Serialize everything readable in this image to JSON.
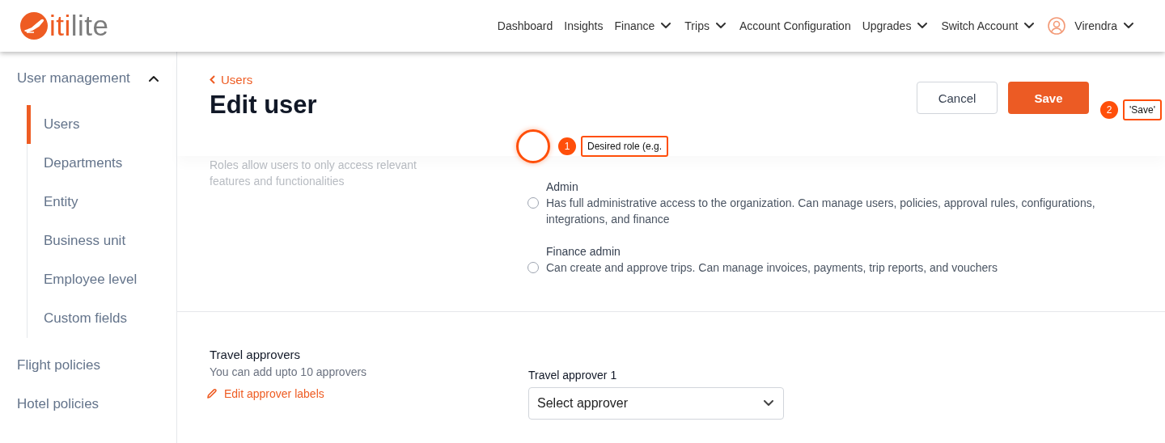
{
  "logo": {
    "accent": "iti",
    "rest": "lite"
  },
  "nav": [
    {
      "label": "Dashboard",
      "dropdown": false
    },
    {
      "label": "Insights",
      "dropdown": false
    },
    {
      "label": "Finance",
      "dropdown": true
    },
    {
      "label": "Trips",
      "dropdown": true
    },
    {
      "label": "Account Configuration",
      "dropdown": false
    },
    {
      "label": "Upgrades",
      "dropdown": true
    },
    {
      "label": "Switch Account",
      "dropdown": true
    }
  ],
  "user": {
    "name": "Virendra"
  },
  "sidebar": [
    {
      "label": "User management",
      "expanded": true,
      "children": [
        {
          "label": "Users",
          "selected": true
        },
        {
          "label": "Departments",
          "selected": false
        },
        {
          "label": "Entity",
          "selected": false
        },
        {
          "label": "Business unit",
          "selected": false
        },
        {
          "label": "Employee level",
          "selected": false
        },
        {
          "label": "Custom fields",
          "selected": false
        }
      ]
    },
    {
      "label": "Flight policies"
    },
    {
      "label": "Hotel policies"
    }
  ],
  "breadcrumb": "Users",
  "title": "Edit user",
  "buttons": [
    {
      "label": "Cancel",
      "kind": "secondary"
    },
    {
      "label": "Save",
      "kind": "primary"
    }
  ],
  "roles": {
    "description": "Roles allow users to only access relevant features and functionalities",
    "options": [
      {
        "label": "Admin",
        "description": "Has full administrative access to the organization. Can manage users, policies, approval rules, configurations, integrations, and finance",
        "selected": false
      },
      {
        "label": "Finance admin",
        "description": "Can create and approve trips. Can manage invoices, payments, trip reports, and vouchers",
        "selected": false
      }
    ]
  },
  "approvers": {
    "title": "Travel approvers",
    "subtitle": "You can add upto 10 approvers",
    "edit_link": "Edit approver labels",
    "fields": [
      {
        "label": "Travel approver 1",
        "placeholder": "Select approver"
      }
    ]
  },
  "annotations": [
    {
      "number": "1",
      "text": "Desired role (e.g.",
      "ring": true
    },
    {
      "number": "2",
      "text": "'Save'",
      "ring": false
    }
  ]
}
